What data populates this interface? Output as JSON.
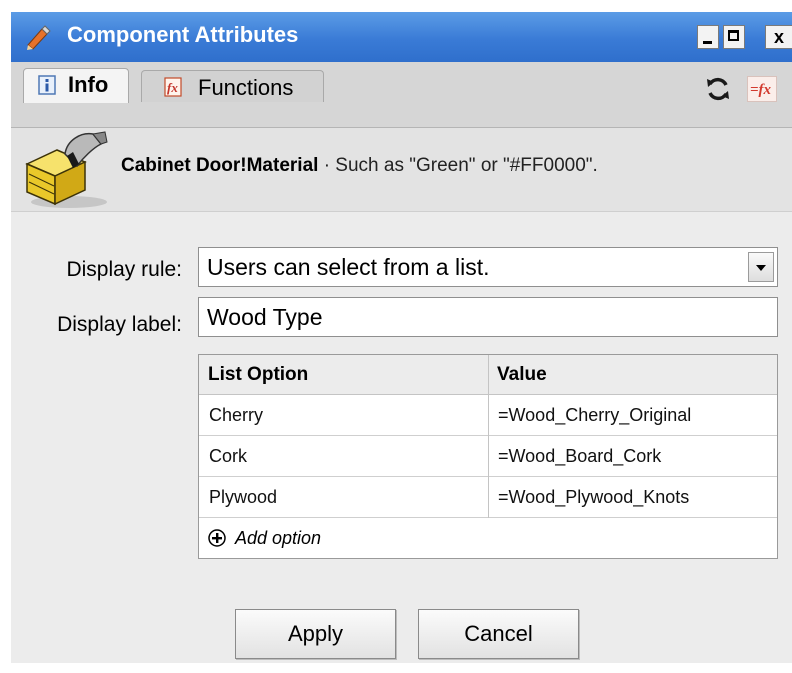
{
  "window": {
    "title": "Component Attributes",
    "controls": {
      "minimize": "_",
      "maximize": "□",
      "close": "x"
    }
  },
  "tabs": [
    {
      "label": "Info",
      "icon": "info-icon",
      "active": true
    },
    {
      "label": "Functions",
      "icon": "functions-icon",
      "active": false
    }
  ],
  "toolbar": {
    "refresh_icon": "refresh-icon",
    "formula_icon": "toggle-formula-icon"
  },
  "component": {
    "title": "Cabinet Door!Material",
    "description": " · Such as \"Green\" or \"#FF0000\"."
  },
  "form": {
    "display_rule_label": "Display rule:",
    "display_rule_value": "Users can select from a list.",
    "display_label_label": "Display label:",
    "display_label_value": "Wood Type"
  },
  "options_table": {
    "headers": [
      "List Option",
      "Value"
    ],
    "rows": [
      {
        "option": "Cherry",
        "value": "=Wood_Cherry_Original"
      },
      {
        "option": "Cork",
        "value": "=Wood_Board_Cork"
      },
      {
        "option": "Plywood",
        "value": "=Wood_Plywood_Knots"
      }
    ],
    "add_label": "Add option"
  },
  "buttons": {
    "apply": "Apply",
    "cancel": "Cancel"
  },
  "colors": {
    "titlebar": "#3a7bd6",
    "title_text": "#ffffff",
    "panel": "#ececec"
  }
}
